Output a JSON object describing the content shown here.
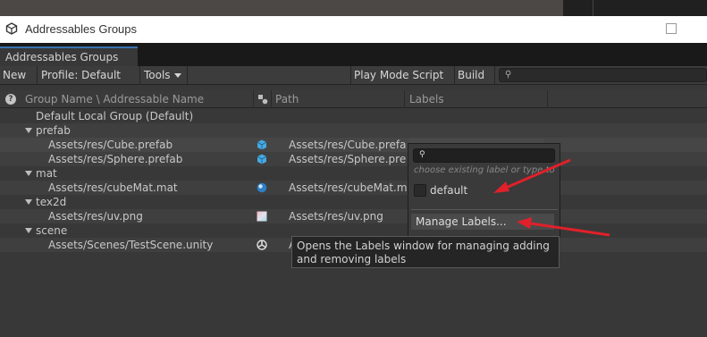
{
  "window": {
    "title": "Addressables Groups",
    "tab_label": "Addressables Groups"
  },
  "toolbar": {
    "new_label": "New",
    "profile_label": "Profile: Default",
    "tools_label": "Tools",
    "play_mode_label": "Play Mode Script",
    "build_label": "Build",
    "search_value": ""
  },
  "columns": {
    "name": "Group Name \\ Addressable Name",
    "path": "Path",
    "labels": "Labels"
  },
  "tree": {
    "default_group": "Default Local Group (Default)",
    "prefab_folder": "prefab",
    "cube_name": "Assets/res/Cube.prefab",
    "cube_path": "Assets/res/Cube.prefa",
    "sphere_name": "Assets/res/Sphere.prefab",
    "sphere_path": "Assets/res/Sphere.pre",
    "mat_folder": "mat",
    "mat_name": "Assets/res/cubeMat.mat",
    "mat_path": "Assets/res/cubeMat.m",
    "tex_folder": "tex2d",
    "tex_name": "Assets/res/uv.png",
    "tex_path": "Assets/res/uv.png",
    "scene_folder": "scene",
    "scene_name": "Assets/Scenes/TestScene.unity",
    "scene_path": "A"
  },
  "popup": {
    "search_value": "",
    "hint": "choose existing label or type to cr",
    "label_default": "default",
    "manage_labels": "Manage Labels..."
  },
  "tooltip": {
    "text": "Opens the Labels window for managing adding and removing labels"
  },
  "colors": {
    "panel": "#383838",
    "tab_accent": "#3a72b0",
    "annotation_arrow": "#e0202a",
    "prefab_icon": "#47a8e0"
  }
}
